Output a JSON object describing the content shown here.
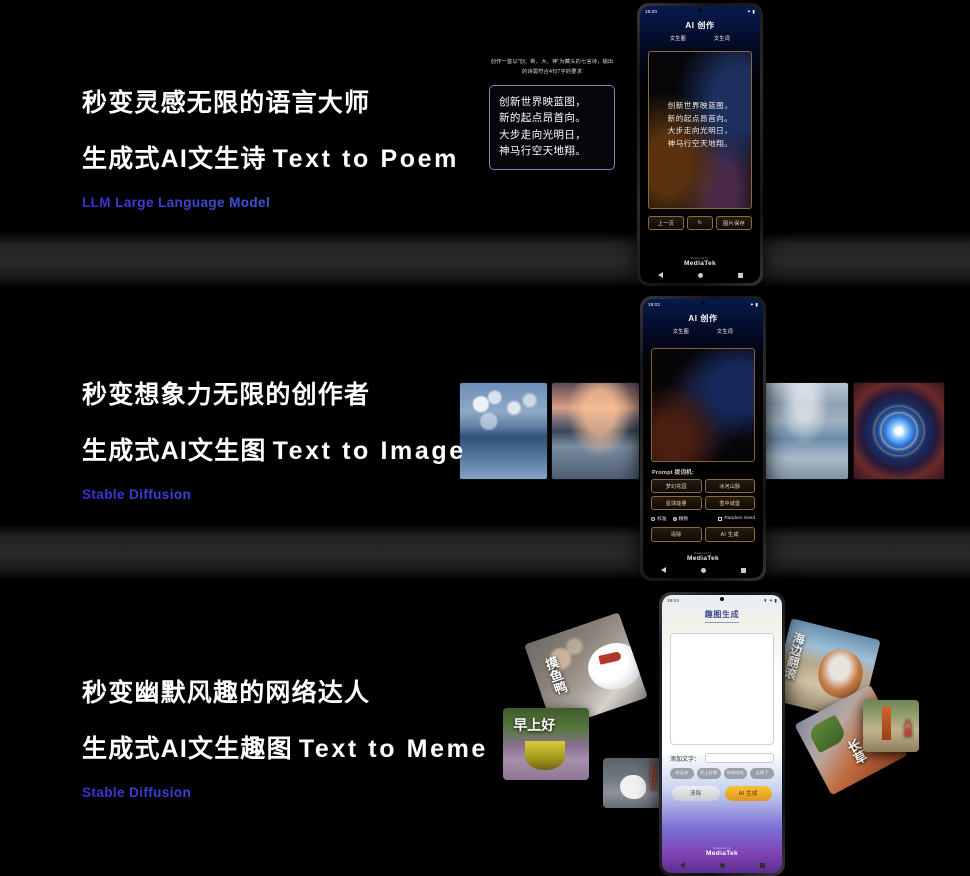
{
  "sections": [
    {
      "id": "poem",
      "headline_cn": "秒变灵感无限的语言大师",
      "headline_main_cn": "生成式AI文生诗",
      "headline_main_en": "Text to Poem",
      "tech_label": "LLM Large Language Model",
      "callout": {
        "prompt_text": "创作一首以\"创、新、大、神\"为藏头的七言诗，输出的诗需符合4句7字的要求",
        "poem_lines": [
          "创新世界映蓝图，",
          "新的起点昂首向。",
          "大步走向光明日，",
          "神马行空天地翔。"
        ]
      },
      "phone": {
        "status_time": "19:00",
        "status_icons": "✦ ▮",
        "app_title": "AI 创作",
        "tabs": [
          "文生图",
          "文生词"
        ],
        "poem_lines": [
          "创新世界映蓝图，",
          "新的起点昂首向。",
          "大步走向光明日，",
          "神马行空天地翔。"
        ],
        "buttons": [
          "上一页",
          "↻",
          "图片保存"
        ],
        "brand_powered": "Powered by",
        "brand_name": "MediaTek"
      }
    },
    {
      "id": "image",
      "headline_cn": "秒变想象力无限的创作者",
      "headline_main_cn": "生成式AI文生图",
      "headline_main_en": "Text to Image",
      "tech_label": "Stable Diffusion",
      "gallery": [
        {
          "name": "clouds-over-water",
          "style": "sc-cloud"
        },
        {
          "name": "sunset-fjord",
          "style": "sc-sunset"
        },
        {
          "name": "rocky-glacier",
          "style": "sc-rock"
        },
        {
          "name": "cosmic-vortex",
          "style": "sc-cosmos"
        }
      ],
      "phone": {
        "status_time": "19:02",
        "status_icons": "✦ ▮",
        "app_title": "AI 创作",
        "tabs": [
          "文生图",
          "文生词"
        ],
        "prompt_label": "Prompt 提词机:",
        "prompt_presets": [
          "梦幻花园",
          "冰河山脉",
          "星球能量",
          "雪中城堡"
        ],
        "options": [
          {
            "label": "标准",
            "type": "radio",
            "selected": false
          },
          {
            "label": "精致",
            "type": "radio",
            "selected": true
          },
          {
            "label": "Random Seed",
            "type": "checkbox",
            "selected": false
          }
        ],
        "buttons": [
          "清除",
          "AI 生成"
        ],
        "brand_powered": "Powered by",
        "brand_name": "MediaTek"
      }
    },
    {
      "id": "meme",
      "headline_cn": "秒变幽默风趣的网络达人",
      "headline_main_cn": "生成式AI文生趣图",
      "headline_main_en": "Text to Meme",
      "tech_label": "Stable Diffusion",
      "cards": [
        {
          "name": "duck-bokeh-card",
          "caption": "摸鱼鸭"
        },
        {
          "name": "morning-bowl-card",
          "caption": "早上好"
        },
        {
          "name": "duck-river-card",
          "caption": "下班快乐"
        },
        {
          "name": "corgi-beach-card",
          "caption": "海边翻滚"
        },
        {
          "name": "carrot-card",
          "caption": "长草"
        },
        {
          "name": "carrot-mini-card",
          "caption": "八道"
        }
      ],
      "phone": {
        "status_time": "19:04",
        "status_icons": "▼ ✦ ▮",
        "app_title": "趣图生成",
        "add_text_label": "添加文字：",
        "add_text_value": "",
        "tags": [
          "好运来",
          "早上好哦",
          "哈哈哈哈",
          "太棒了"
        ],
        "buttons": [
          "清除",
          "AI 生成"
        ],
        "brand_powered": "Powered by",
        "brand_name": "MediaTek"
      }
    }
  ]
}
